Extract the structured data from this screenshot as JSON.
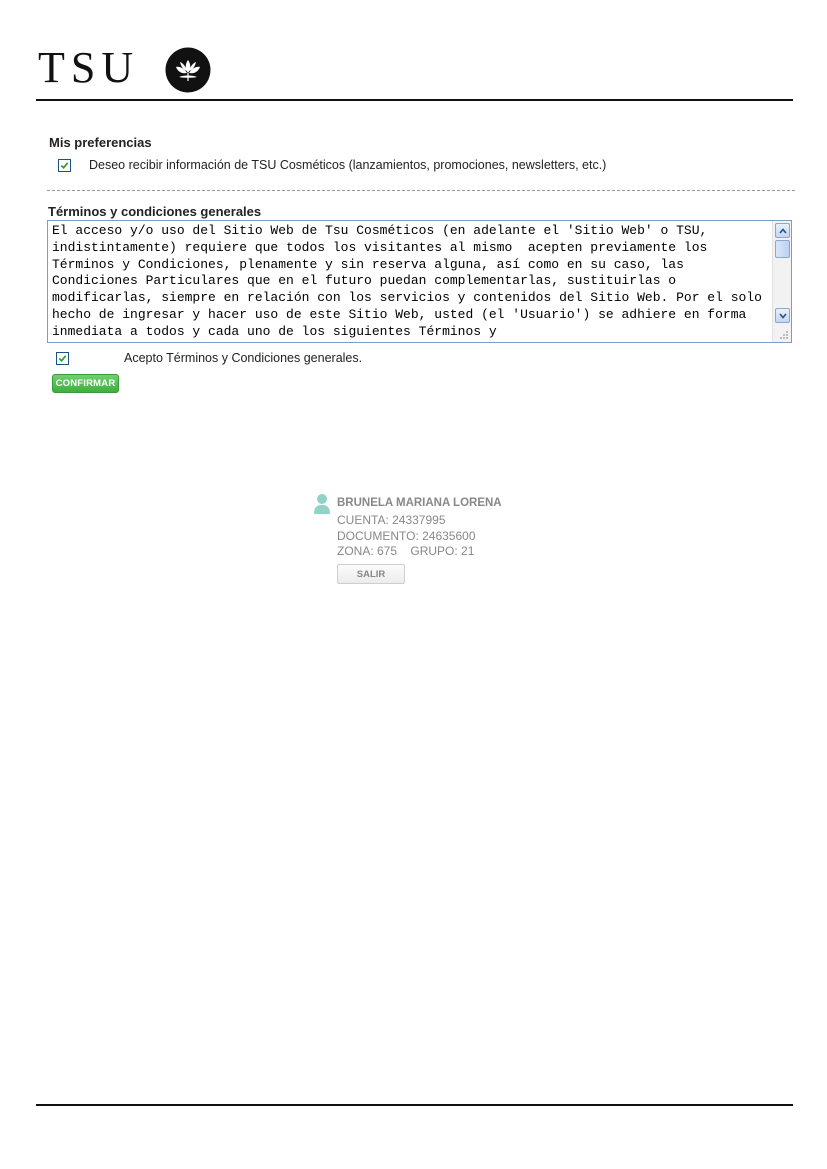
{
  "header": {
    "logo_text": "TSU",
    "logo_icon": "lotus-flower-icon"
  },
  "preferences": {
    "title": "Mis preferencias",
    "newsletter_checked": true,
    "newsletter_label": "Deseo recibir información de TSU Cosméticos (lanzamientos, promociones, newsletters, etc.)"
  },
  "terms": {
    "title": "Términos y condiciones generales",
    "text": "El acceso y/o uso del Sitio Web de Tsu Cosméticos (en adelante el 'Sitio Web' o TSU, indistintamente) requiere que todos los visitantes al mismo  acepten previamente los Términos y Condiciones, plenamente y sin reserva alguna, así como en su caso, las Condiciones Particulares que en el futuro puedan complementarlas, sustituirlas o modificarlas, siempre en relación con los servicios y contenidos del Sitio Web. Por el solo hecho de ingresar y hacer uso de este Sitio Web, usted (el 'Usuario') se adhiere en forma inmediata a todos y cada uno de los siguientes Términos y",
    "accept_checked": true,
    "accept_label": "Acepto Términos y Condiciones generales.",
    "confirm_label": "CONFIRMAR"
  },
  "user": {
    "icon": "user-icon",
    "name": "BRUNELA MARIANA LORENA",
    "cuenta": "CUENTA: 24337995",
    "documento": "DOCUMENTO: 24635600",
    "zona_grupo": "ZONA: 675    GRUPO: 21",
    "logout_label": "SALIR"
  },
  "colors": {
    "confirm_green": "#4cbb4c",
    "muted_text": "#888888",
    "textarea_border": "#7a9cc6"
  }
}
